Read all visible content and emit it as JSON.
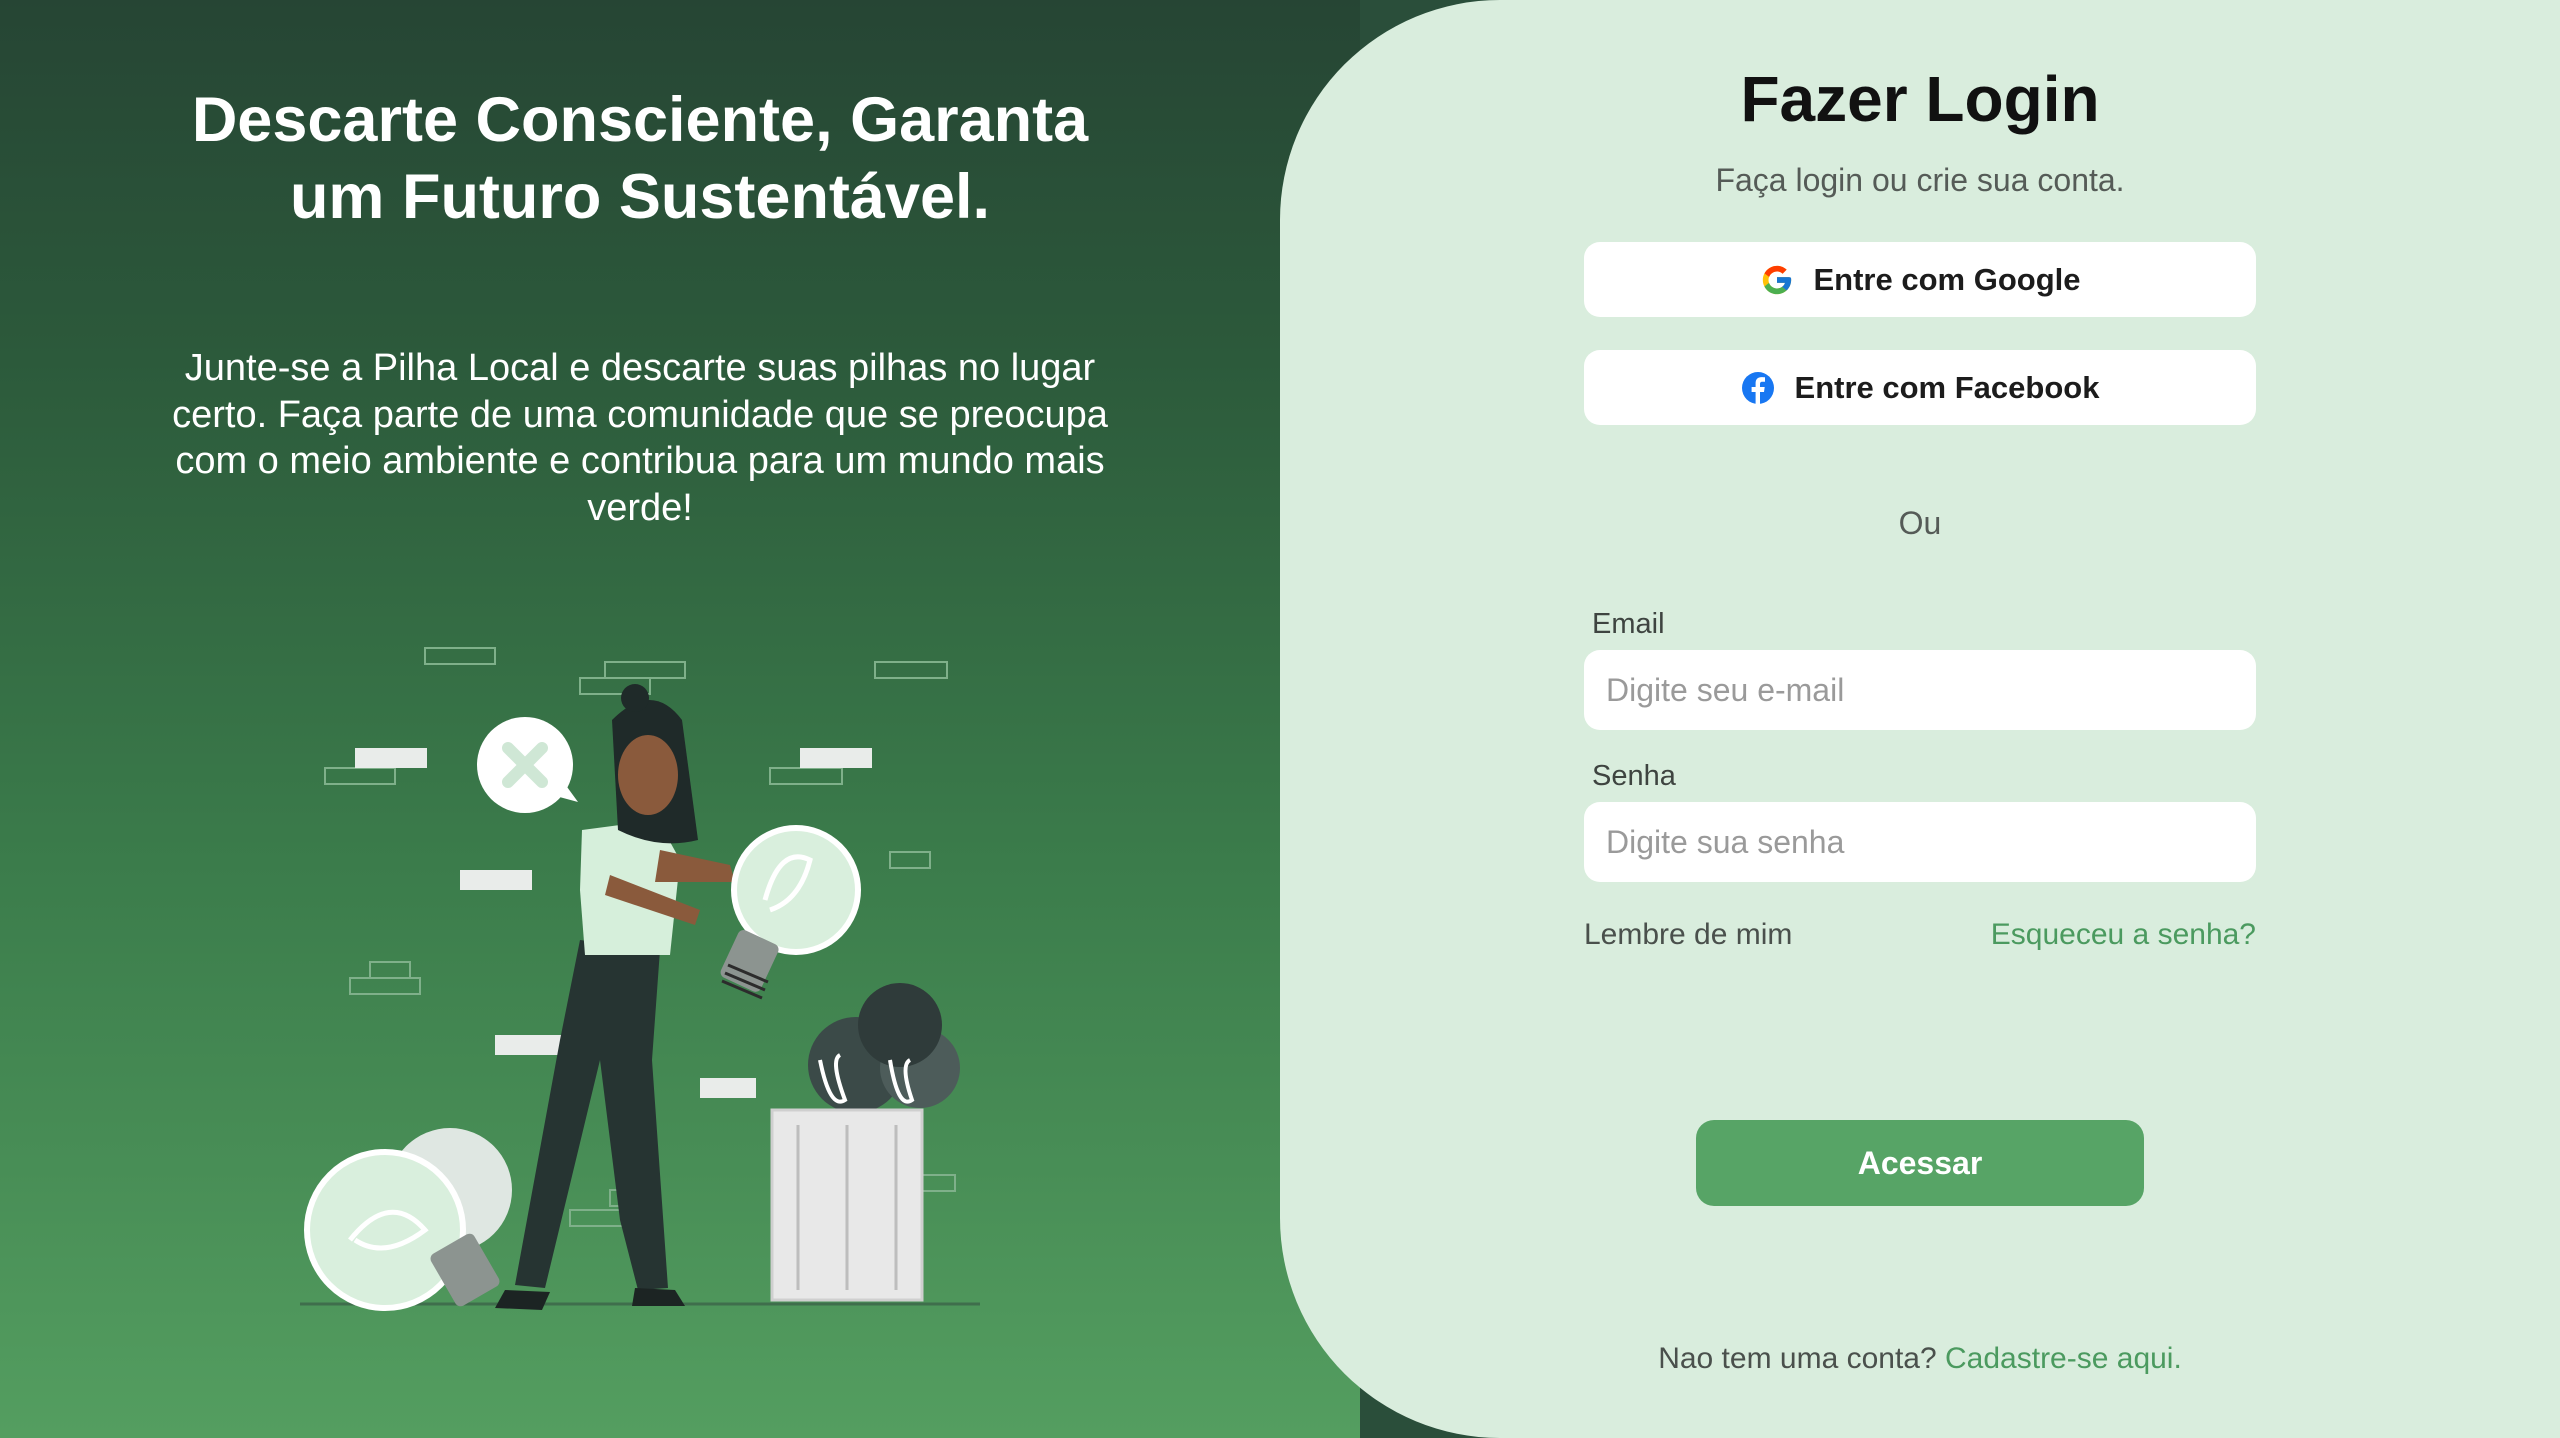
{
  "hero": {
    "headline": "Descarte Consciente, Garanta um Futuro Sustentável.",
    "description": "Junte-se a Pilha Local e descarte suas pilhas no lugar certo. Faça parte de uma comunidade que se preocupa com o meio ambiente e contribua para um mundo mais verde!"
  },
  "login": {
    "title": "Fazer Login",
    "subtitle": "Faça login ou crie sua conta.",
    "google_label": "Entre com Google",
    "facebook_label": "Entre com Facebook",
    "divider": "Ou",
    "email_label": "Email",
    "email_placeholder": "Digite seu e-mail",
    "password_label": "Senha",
    "password_placeholder": "Digite sua senha",
    "remember_label": "Lembre de mim",
    "forgot_label": "Esqueceu a senha?",
    "submit_label": "Acessar",
    "signup_prompt": "Nao tem uma conta?",
    "signup_link": "Cadastre-se aqui."
  },
  "icons": {
    "google": "google-icon",
    "facebook": "facebook-icon"
  },
  "colors": {
    "accent": "#57a466",
    "link": "#4b9a5f",
    "panel_bg": "#d9eddd",
    "hero_dark": "#264534"
  }
}
